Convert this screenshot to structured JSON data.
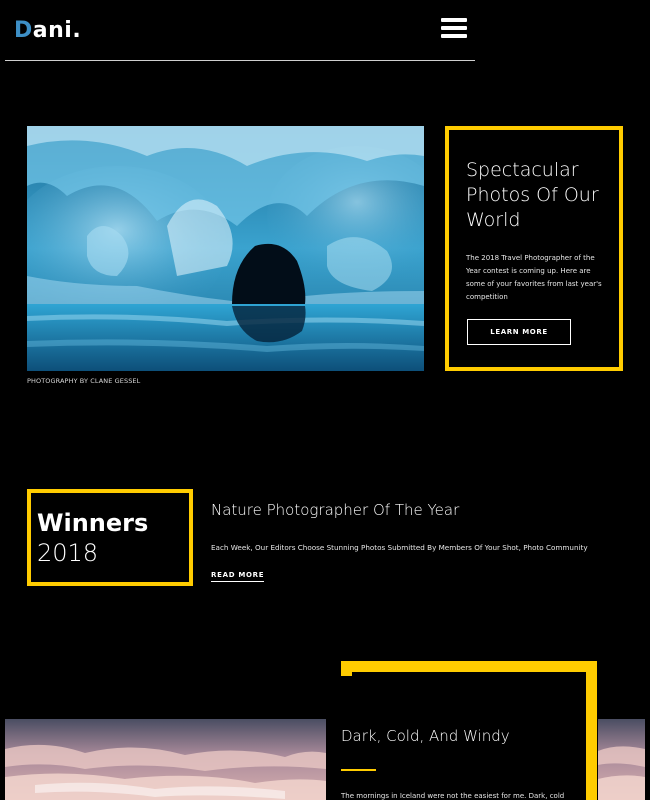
{
  "header": {
    "logo_first": "D",
    "logo_rest": "ani.",
    "menu_icon": "hamburger-menu-icon"
  },
  "hero": {
    "image": "ice-cave-photo",
    "credit": "PHOTOGRAPHY BY CLANE GESSEL",
    "title": "Spectacular Photos Of Our World",
    "description": "The 2018 Travel Photographer of the Year contest is coming up. Here are some of your favorites from last year's competition",
    "button_label": "LEARN MORE"
  },
  "winners": {
    "label": "Winners",
    "year": "2018",
    "title": "Nature Photographer Of The Year",
    "description": "Each Week, Our Editors Choose Stunning Photos Submitted By Members Of Your Shot, Photo Community",
    "link_label": "READ MORE"
  },
  "story": {
    "image": "cloudy-sky-photo",
    "title": "Dark, Cold, And Windy",
    "description": "The mornings in Iceland were not the easiest for me. Dark, cold"
  },
  "colors": {
    "background": "#000000",
    "accent": "#ffcc00",
    "logo_accent": "#3d8fc6",
    "text": "#ffffff"
  }
}
